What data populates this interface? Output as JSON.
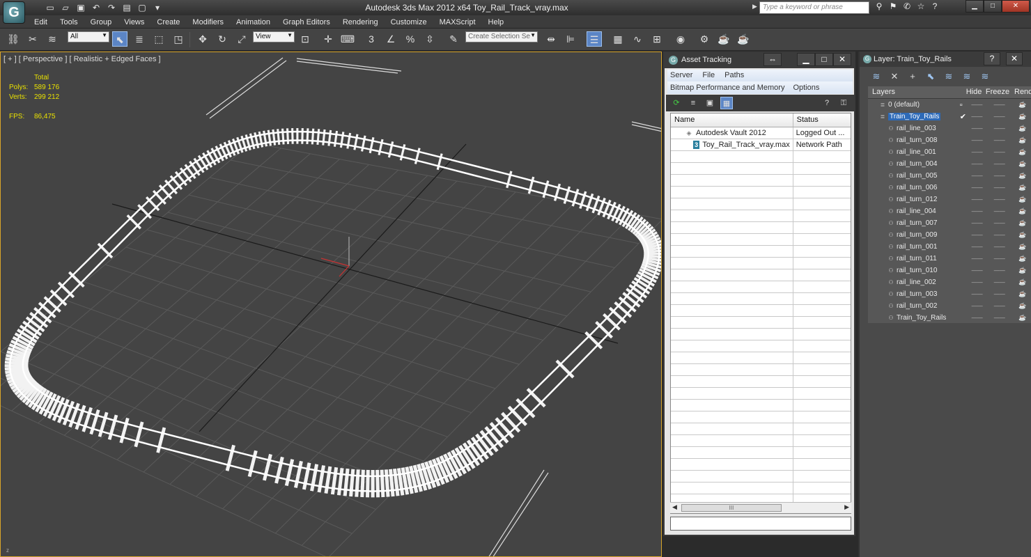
{
  "window": {
    "title": "Autodesk 3ds Max  2012 x64     Toy_Rail_Track_vray.max",
    "search_placeholder": "Type a keyword or phrase"
  },
  "menu": [
    "Edit",
    "Tools",
    "Group",
    "Views",
    "Create",
    "Modifiers",
    "Animation",
    "Graph Editors",
    "Rendering",
    "Customize",
    "MAXScript",
    "Help"
  ],
  "toolbar": {
    "selection_filter": "All",
    "ref_coord": "View",
    "selection_set_placeholder": "Create Selection Se",
    "snap_label": "3",
    "angle_snap_label": "%"
  },
  "viewport": {
    "label": "[ + ] [ Perspective ] [ Realistic + Edged Faces ]",
    "stats": {
      "header": "Total",
      "polys_label": "Polys:",
      "polys": "589 176",
      "verts_label": "Verts:",
      "verts": "299 212",
      "fps_label": "FPS:",
      "fps": "86,475"
    },
    "axis_label": "z"
  },
  "asset_tracking": {
    "title": "Asset Tracking",
    "menu1": [
      "Server",
      "File",
      "Paths"
    ],
    "menu2": [
      "Bitmap Performance and Memory",
      "Options"
    ],
    "col_name": "Name",
    "col_status": "Status",
    "rows": [
      {
        "name": "Autodesk Vault 2012",
        "status": "Logged Out ...",
        "icon": "vault-icon"
      },
      {
        "name": "Toy_Rail_Track_vray.max",
        "status": "Network Path",
        "icon": "max-file-icon"
      }
    ],
    "scroll_thumb": "III"
  },
  "layer_panel": {
    "title": "Layer: Train_Toy_Rails",
    "col_layers": "Layers",
    "col_hide": "Hide",
    "col_freeze": "Freeze",
    "col_render": "Rende",
    "layers": [
      {
        "name": "0 (default)",
        "type": "layer",
        "selected": false,
        "current": false
      },
      {
        "name": "Train_Toy_Rails",
        "type": "layer",
        "selected": true,
        "current": true
      },
      {
        "name": "rail_line_003",
        "type": "object"
      },
      {
        "name": "rail_turn_008",
        "type": "object"
      },
      {
        "name": "rail_line_001",
        "type": "object"
      },
      {
        "name": "rail_turn_004",
        "type": "object"
      },
      {
        "name": "rail_turn_005",
        "type": "object"
      },
      {
        "name": "rail_turn_006",
        "type": "object"
      },
      {
        "name": "rail_turn_012",
        "type": "object"
      },
      {
        "name": "rail_line_004",
        "type": "object"
      },
      {
        "name": "rail_turn_007",
        "type": "object"
      },
      {
        "name": "rail_turn_009",
        "type": "object"
      },
      {
        "name": "rail_turn_001",
        "type": "object"
      },
      {
        "name": "rail_turn_011",
        "type": "object"
      },
      {
        "name": "rail_turn_010",
        "type": "object"
      },
      {
        "name": "rail_line_002",
        "type": "object"
      },
      {
        "name": "rail_turn_003",
        "type": "object"
      },
      {
        "name": "rail_turn_002",
        "type": "object"
      },
      {
        "name": "Train_Toy_Rails",
        "type": "object"
      }
    ]
  },
  "colors": {
    "viewport_bg": "#444444",
    "stats_text": "#e9e100",
    "selection_blue": "#2d6ab8",
    "active_viewport_border": "#d9a62a"
  }
}
